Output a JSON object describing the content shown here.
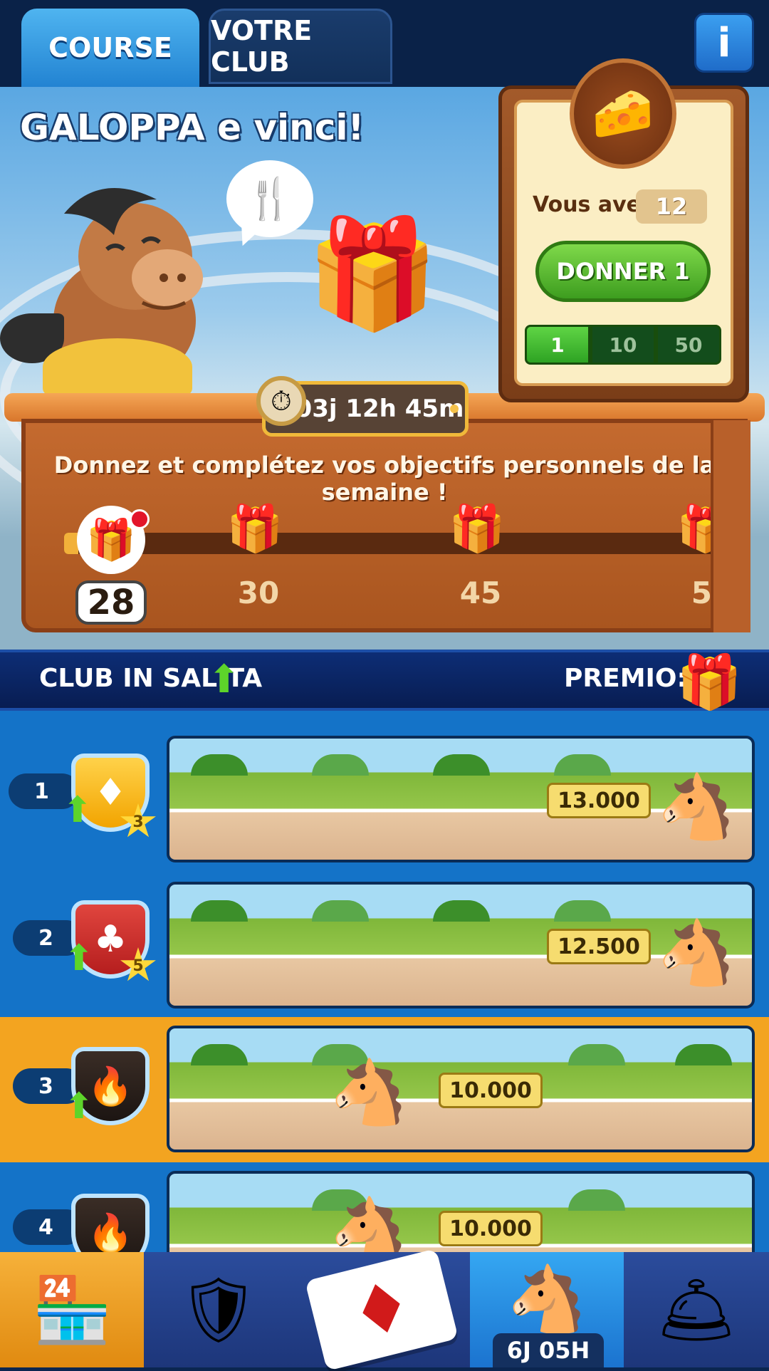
{
  "tabs": {
    "course": "COURSE",
    "club": "VOTRE CLUB",
    "info": "i"
  },
  "scene": {
    "title": "GALOPPA e vinci!",
    "speech_icon": "🍴",
    "gift_icon": "🎁",
    "timer": "03j 12h 45m",
    "description": "Donnez et complétez vos objectifs personnels de la semaine !",
    "current_score": "28",
    "milestones": [
      "30",
      "45",
      "5"
    ]
  },
  "donation": {
    "item_icon": "🧀",
    "have_label": "Vous avez :",
    "have_value": "12",
    "give_button": "DONNER 1",
    "amounts": [
      "1",
      "10",
      "50"
    ],
    "selected_amount": "1"
  },
  "club_header": {
    "title": "CLUB IN SALITA",
    "prize_label": "PREMIO:"
  },
  "ranking": [
    {
      "rank": "1",
      "crest_icon": "♦",
      "stars": "3",
      "score": "13.000"
    },
    {
      "rank": "2",
      "crest_icon": "♣",
      "stars": "5",
      "score": "12.500"
    },
    {
      "rank": "3",
      "crest_icon": "🔥",
      "stars": "",
      "score": "10.000"
    },
    {
      "rank": "4",
      "crest_icon": "🔥",
      "stars": "",
      "score": "10.000"
    }
  ],
  "bottom_nav": {
    "race_timer": "6J 05H"
  },
  "colors": {
    "accent_green": "#5dd42a",
    "highlight_row": "#f3a420",
    "primary_blue": "#1473c8"
  }
}
